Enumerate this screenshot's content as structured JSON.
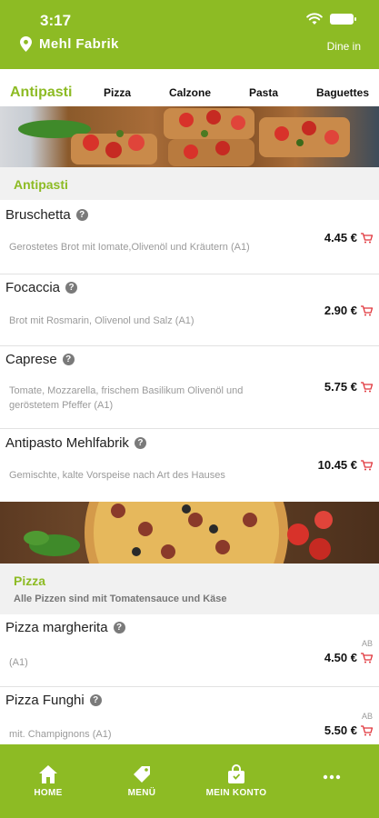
{
  "status_bar": {
    "time": "3:17"
  },
  "header": {
    "restaurant_name": "Mehl Fabrik",
    "dine_in_label": "Dine in"
  },
  "tabs": [
    {
      "label": "Antipasti",
      "active": true
    },
    {
      "label": "Pizza",
      "active": false
    },
    {
      "label": "Calzone",
      "active": false
    },
    {
      "label": "Pasta",
      "active": false
    },
    {
      "label": "Baguettes",
      "active": false
    }
  ],
  "sections": {
    "antipasti": {
      "title": "Antipasti",
      "items": [
        {
          "name": "Bruschetta",
          "description": "Gerostetes Brot mit Iomate,Olivenöl und Kräutern (A1)",
          "price": "4.45 €"
        },
        {
          "name": "Focaccia",
          "description": "Brot mit Rosmarin, Olivenol und Salz (A1)",
          "price": "2.90 €"
        },
        {
          "name": "Caprese",
          "description": "Tomate, Mozzarella, frischem Basilikum Olivenöl und geröstetem Pfeffer (A1)",
          "price": "5.75 €"
        },
        {
          "name": "Antipasto Mehlfabrik",
          "description": "Gemischte, kalte Vorspeise nach Art des Hauses",
          "price": "10.45 €"
        }
      ]
    },
    "pizza": {
      "title": "Pizza",
      "subtitle": "Alle Pizzen sind mit Tomatensauce und Käse",
      "items": [
        {
          "name": "Pizza margherita",
          "description": "(A1)",
          "price": "4.50 €",
          "price_prefix": "AB"
        },
        {
          "name": "Pizza Funghi",
          "description": "mit. Champignons (A1)",
          "price": "5.50 €",
          "price_prefix": "AB"
        }
      ]
    }
  },
  "bottom_nav": [
    {
      "label": "HOME",
      "icon": "home-icon"
    },
    {
      "label": "MENÜ",
      "icon": "tag-icon"
    },
    {
      "label": "MEIN KONTO",
      "icon": "bag-icon"
    },
    {
      "label": "",
      "icon": "more-icon"
    }
  ],
  "colors": {
    "brand": "#8dbb24",
    "cart": "#e0353b"
  }
}
